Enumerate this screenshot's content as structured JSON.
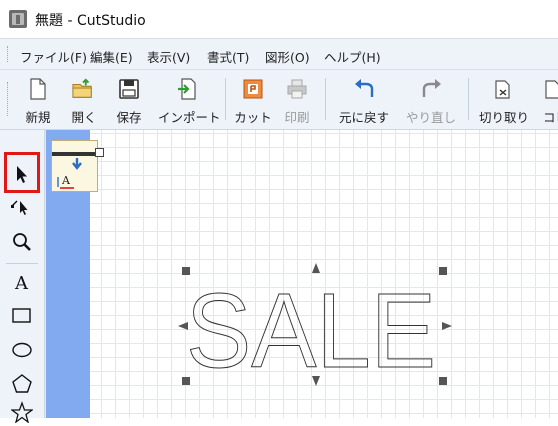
{
  "window": {
    "title": "無題 - CutStudio"
  },
  "menu": [
    "ファイル(F)",
    "編集(E)",
    "表示(V)",
    "書式(T)",
    "図形(O)",
    "ヘルプ(H)"
  ],
  "toolbar": {
    "new": "新規",
    "open": "開く",
    "save": "保存",
    "import": "インポート",
    "cut": "カット",
    "print": "印刷",
    "undo": "元に戻す",
    "redo": "やり直し",
    "cut_out": "切り取り",
    "copy": "コピ"
  },
  "canvas": {
    "text": "SALE"
  },
  "colors": {
    "highlight": "#e01818",
    "ruler_blue": "#82aaf0",
    "accent_green": "#2e9e2e",
    "undo_blue": "#2b6cc4"
  },
  "icons": {
    "tools": [
      "select-arrow-icon",
      "node-edit-icon",
      "zoom-icon",
      "text-tool-icon",
      "rectangle-tool-icon",
      "ellipse-tool-icon",
      "polygon-tool-icon",
      "star-tool-icon"
    ]
  }
}
